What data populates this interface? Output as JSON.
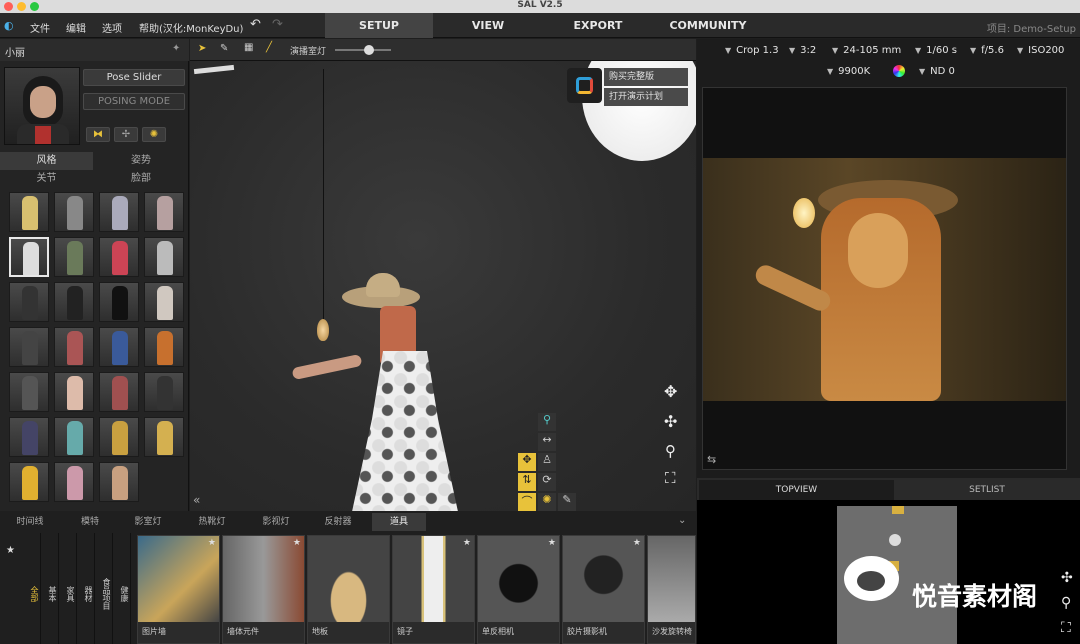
{
  "app": {
    "title": "SAL V2.5",
    "project": "项目: Demo-Setup"
  },
  "menu": [
    "文件",
    "编辑",
    "选项",
    "帮助(汉化:MonKeyDu)"
  ],
  "main_tabs": [
    "SETUP",
    "VIEW",
    "EXPORT",
    "COMMUNITY"
  ],
  "left": {
    "character_name": "小丽",
    "pose_slider": "Pose Slider",
    "posing_mode": "POSING MODE",
    "tabs_row1": [
      "风格",
      "姿势"
    ],
    "tabs_row2": [
      "关节",
      "脸部"
    ]
  },
  "viewport": {
    "light_label": "演播室灯",
    "menu_items": [
      "购买完整版",
      "打开演示计划"
    ]
  },
  "camera": {
    "crop": "Crop 1.3",
    "ratio": "3:2",
    "lens": "24-105 mm",
    "shutter": "1/60 s",
    "aperture": "f/5.6",
    "iso": "ISO200",
    "white_balance": "9900K",
    "nd": "ND 0"
  },
  "bottom": {
    "tabs": [
      "时间线",
      "模特",
      "影室灯",
      "热靴灯",
      "影视灯",
      "反射器",
      "道具"
    ],
    "categories": [
      "全部",
      "基本",
      "家具",
      "器材",
      "食品项目",
      "健康"
    ],
    "props": [
      "图片墙",
      "墙体元件",
      "地板",
      "镜子",
      "单反相机",
      "胶片摄影机",
      "沙发旋转椅"
    ]
  },
  "topview": {
    "tabs": [
      "TOPVIEW",
      "SETLIST"
    ]
  },
  "watermark": "悦音素材阁",
  "colors": {
    "accent_yellow": "#e8c23a",
    "setup_tab_bg": "#444444"
  }
}
